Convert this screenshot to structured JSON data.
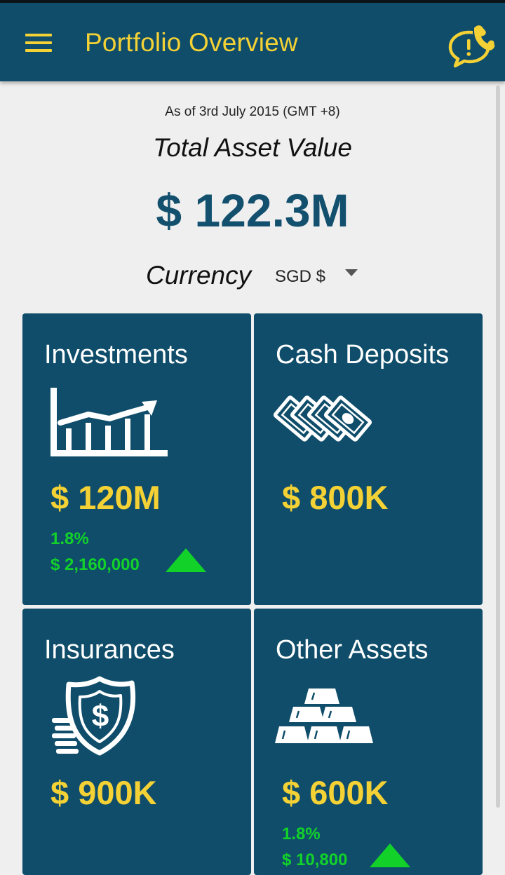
{
  "header": {
    "title": "Portfolio Overview",
    "menu_icon": "hamburger-menu-icon",
    "contact_icon": "phone-alert-icon"
  },
  "summary": {
    "as_of": "As of 3rd July 2015 (GMT +8)",
    "total_label": "Total Asset Value",
    "total_value": "$ 122.3M",
    "currency_label": "Currency",
    "currency_value": "SGD $"
  },
  "cards": [
    {
      "title": "Investments",
      "icon": "growth-chart-icon",
      "value": "$ 120M",
      "change_pct": "1.8%",
      "change_amount": "$ 2,160,000",
      "trend": "up"
    },
    {
      "title": "Cash Deposits",
      "icon": "banknotes-icon",
      "value": "$ 800K"
    },
    {
      "title": "Insurances",
      "icon": "shield-dollar-icon",
      "value": "$ 900K"
    },
    {
      "title": "Other Assets",
      "icon": "gold-bars-icon",
      "value": "$ 600K",
      "change_pct": "1.8%",
      "change_amount": "$ 10,800",
      "trend": "up"
    }
  ],
  "colors": {
    "header_bg": "#0f4d6a",
    "card_bg": "#0f4d6a",
    "accent_yellow": "#f4d135",
    "positive_green": "#12d22a",
    "total_value_blue": "#12506e"
  }
}
